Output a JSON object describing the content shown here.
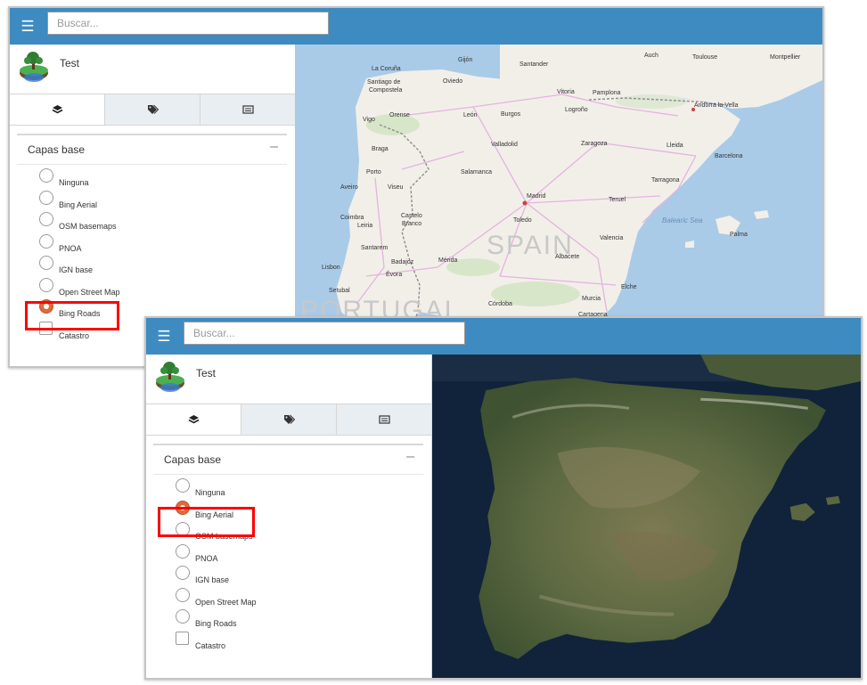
{
  "windows": [
    {
      "search_placeholder": "Buscar...",
      "app_title": "Test",
      "panel_title": "Capas base",
      "collapse_symbol": "–",
      "menu_icon": "☰",
      "layers": [
        {
          "label": "Ninguna",
          "type": "radio",
          "checked": false
        },
        {
          "label": "Bing Aerial",
          "type": "radio",
          "checked": false
        },
        {
          "label": "OSM basemaps",
          "type": "radio",
          "checked": false
        },
        {
          "label": "PNOA",
          "type": "radio",
          "checked": false
        },
        {
          "label": "IGN base",
          "type": "radio",
          "checked": false
        },
        {
          "label": "Open Street Map",
          "type": "radio",
          "checked": false
        },
        {
          "label": "Bing Roads",
          "type": "radio",
          "checked": true
        },
        {
          "label": "Catastro",
          "type": "checkbox",
          "checked": false
        }
      ],
      "map": {
        "type": "road",
        "country_labels": [
          "SPAIN",
          "PORTUGAL"
        ],
        "sea_labels": [
          "Balearic Sea"
        ],
        "places": [
          "Gijón",
          "Santander",
          "Auch",
          "Toulouse",
          "Montpellier",
          "La Coruña",
          "Oviedo",
          "Santiago de",
          "Compostela",
          "Vitoria",
          "Pamplona",
          "Andorra la Vella",
          "Vigo",
          "Orense",
          "León",
          "Burgos",
          "Logroño",
          "Braga",
          "Valladolid",
          "Zaragoza",
          "Lleida",
          "Barcelona",
          "Porto",
          "Salamanca",
          "Tarragona",
          "Aveiro",
          "Viseu",
          "Madrid",
          "Teruel",
          "Coimbra",
          "Leiria",
          "Castelo",
          "Branco",
          "Toledo",
          "Palma",
          "Santarem",
          "Valencia",
          "Lisbon",
          "Badajoz",
          "Mérida",
          "Albacete",
          "Évora",
          "Setubal",
          "Elche",
          "Murcia",
          "Córdoba",
          "Cartagena"
        ]
      }
    },
    {
      "search_placeholder": "Buscar...",
      "app_title": "Test",
      "panel_title": "Capas base",
      "collapse_symbol": "–",
      "menu_icon": "☰",
      "layers": [
        {
          "label": "Ninguna",
          "type": "radio",
          "checked": false
        },
        {
          "label": "Bing Aerial",
          "type": "radio",
          "checked": true
        },
        {
          "label": "OSM basemaps",
          "type": "radio",
          "checked": false
        },
        {
          "label": "PNOA",
          "type": "radio",
          "checked": false
        },
        {
          "label": "IGN base",
          "type": "radio",
          "checked": false
        },
        {
          "label": "Open Street Map",
          "type": "radio",
          "checked": false
        },
        {
          "label": "Bing Roads",
          "type": "radio",
          "checked": false
        },
        {
          "label": "Catastro",
          "type": "checkbox",
          "checked": false
        }
      ],
      "map": {
        "type": "aerial"
      }
    }
  ],
  "colors": {
    "header": "#3d8bc1",
    "highlight": "#ff0000",
    "radio_checked": "#e06a3b",
    "sea": "#a9cbe8",
    "land": "#f2efe9",
    "aerial_sea": "#10233a",
    "aerial_land": "#5e6a42"
  }
}
